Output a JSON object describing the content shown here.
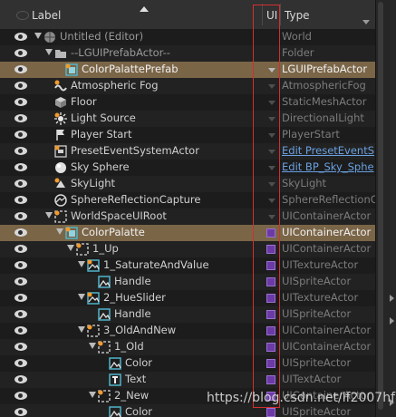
{
  "header": {
    "label_col": "Label",
    "ui_col": "UI",
    "type_col": "Type"
  },
  "rows": [
    {
      "label": "Untitled (Editor)",
      "type": "World",
      "icon": "world-icon",
      "depth": 0,
      "arrow": true,
      "eye": true,
      "ui": "none",
      "dim": true
    },
    {
      "label": "--LGUIPrefabActor--",
      "type": "Folder",
      "icon": "folder-icon",
      "depth": 1,
      "arrow": true,
      "eye": true,
      "ui": "none",
      "dim": true
    },
    {
      "label": "ColorPalattePrefab",
      "type": "LGUIPrefabActor",
      "icon": "prefab-icon",
      "depth": 2,
      "arrow": false,
      "eye": true,
      "ui": "drop",
      "sel": true
    },
    {
      "label": "Atmospheric Fog",
      "type": "AtmosphericFog",
      "icon": "fog-icon",
      "depth": 1,
      "arrow": false,
      "eye": true,
      "ui": "dropdim"
    },
    {
      "label": "Floor",
      "type": "StaticMeshActor",
      "icon": "mesh-icon",
      "depth": 1,
      "arrow": false,
      "eye": true,
      "ui": "dropdim"
    },
    {
      "label": "Light Source",
      "type": "DirectionalLight",
      "icon": "light-icon",
      "depth": 1,
      "arrow": false,
      "eye": true,
      "ui": "dropdim"
    },
    {
      "label": "Player Start",
      "type": "PlayerStart",
      "icon": "flag-icon",
      "depth": 1,
      "arrow": false,
      "eye": true,
      "ui": "dropdim"
    },
    {
      "label": "PresetEventSystemActor",
      "type": "Edit PresetEventS",
      "icon": "event-icon",
      "depth": 1,
      "arrow": false,
      "eye": true,
      "ui": "dropdim",
      "link": true
    },
    {
      "label": "Sky Sphere",
      "type": "Edit BP_Sky_Sphe",
      "icon": "sphere-icon",
      "depth": 1,
      "arrow": false,
      "eye": true,
      "ui": "dropdim",
      "link": true
    },
    {
      "label": "SkyLight",
      "type": "SkyLight",
      "icon": "skylight-icon",
      "depth": 1,
      "arrow": false,
      "eye": true,
      "ui": "dropdim"
    },
    {
      "label": "SphereReflectionCapture",
      "type": "SphereReflectionCa",
      "icon": "reflection-icon",
      "depth": 1,
      "arrow": false,
      "eye": true,
      "ui": "dropdim"
    },
    {
      "label": "WorldSpaceUIRoot",
      "type": "UIContainerActor",
      "icon": "container-icon",
      "depth": 1,
      "arrow": true,
      "eye": true,
      "ui": "dropdim"
    },
    {
      "label": "ColorPalatte",
      "type": "UIContainerActor",
      "icon": "prefab-icon",
      "depth": 2,
      "arrow": true,
      "eye": true,
      "ui": "box",
      "sel": true
    },
    {
      "label": "1_Up",
      "type": "UIContainerActor",
      "icon": "container-icon",
      "depth": 3,
      "arrow": true,
      "eye": true,
      "ui": "box"
    },
    {
      "label": "1_SaturateAndValue",
      "type": "UITextureActor",
      "icon": "texture-icon",
      "depth": 4,
      "arrow": true,
      "eye": true,
      "ui": "box"
    },
    {
      "label": "Handle",
      "type": "UISpriteActor",
      "icon": "sprite-icon",
      "depth": 5,
      "arrow": false,
      "eye": true,
      "ui": "box"
    },
    {
      "label": "2_HueSlider",
      "type": "UITextureActor",
      "icon": "texture-icon",
      "depth": 4,
      "arrow": true,
      "eye": true,
      "ui": "box"
    },
    {
      "label": "Handle",
      "type": "UISpriteActor",
      "icon": "sprite-icon",
      "depth": 5,
      "arrow": false,
      "eye": true,
      "ui": "box"
    },
    {
      "label": "3_OldAndNew",
      "type": "UIContainerActor",
      "icon": "container-icon",
      "depth": 4,
      "arrow": true,
      "eye": true,
      "ui": "box"
    },
    {
      "label": "1_Old",
      "type": "UIContainerActor",
      "icon": "container-icon",
      "depth": 5,
      "arrow": true,
      "eye": true,
      "ui": "box"
    },
    {
      "label": "Color",
      "type": "UISpriteActor",
      "icon": "sprite-icon",
      "depth": 6,
      "arrow": false,
      "eye": true,
      "ui": "box"
    },
    {
      "label": "Text",
      "type": "UITextActor",
      "icon": "text-icon",
      "depth": 6,
      "arrow": false,
      "eye": true,
      "ui": "box"
    },
    {
      "label": "2_New",
      "type": "UIContainerActor",
      "icon": "container-icon",
      "depth": 5,
      "arrow": true,
      "eye": true,
      "ui": "box"
    },
    {
      "label": "Color",
      "type": "UISpriteActor",
      "icon": "sprite-icon",
      "depth": 6,
      "arrow": false,
      "eye": true,
      "ui": "box"
    }
  ],
  "watermark": "https://blog.csdn.net/lf2007hf",
  "colors": {
    "selected": "#7a6547",
    "highlight": "#d32f2f",
    "ui_box": "#6b3aa6",
    "link": "#6aa0e0"
  }
}
